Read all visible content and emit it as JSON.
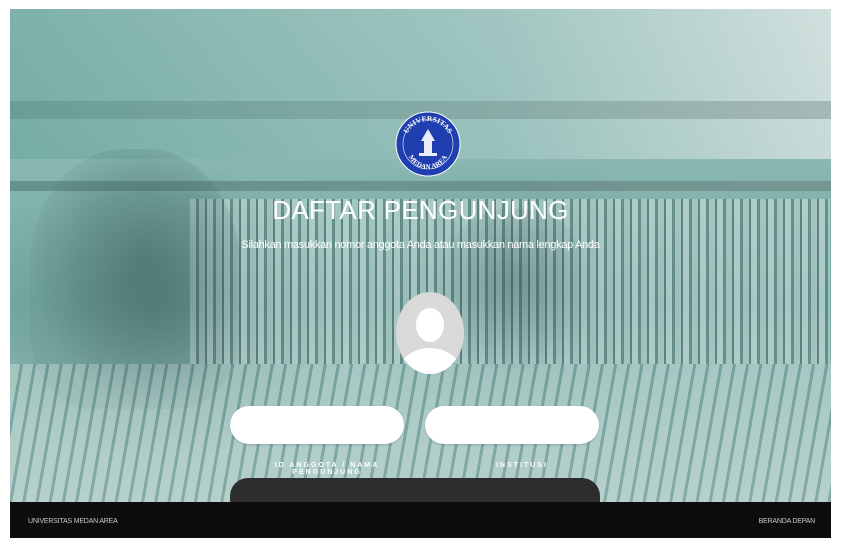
{
  "logo": {
    "top_text": "UNIVERSITAS",
    "bottom_text": "MEDAN AREA"
  },
  "header": {
    "title": "DAFTAR PENGUNJUNG",
    "subtitle": "Silahkan masukkan nomor anggota Anda atau masukkan nama lengkap Anda"
  },
  "avatar": {
    "icon": "user-silhouette-icon"
  },
  "form": {
    "member_field": {
      "value": "",
      "label": "ID ANGGOTA / NAMA PENGUNJUNG"
    },
    "institution_field": {
      "value": "",
      "label": "INSTITUSI"
    },
    "submit_label": ""
  },
  "footer": {
    "left_text": "UNIVERSITAS MEDAN AREA",
    "right_link": "BERANDA DEPAN"
  },
  "colors": {
    "overlay_teal": "#79ada6",
    "logo_blue": "#1f3fb0",
    "footer_bg": "#0d0d0d",
    "submit_bg": "#2d2d2d"
  }
}
